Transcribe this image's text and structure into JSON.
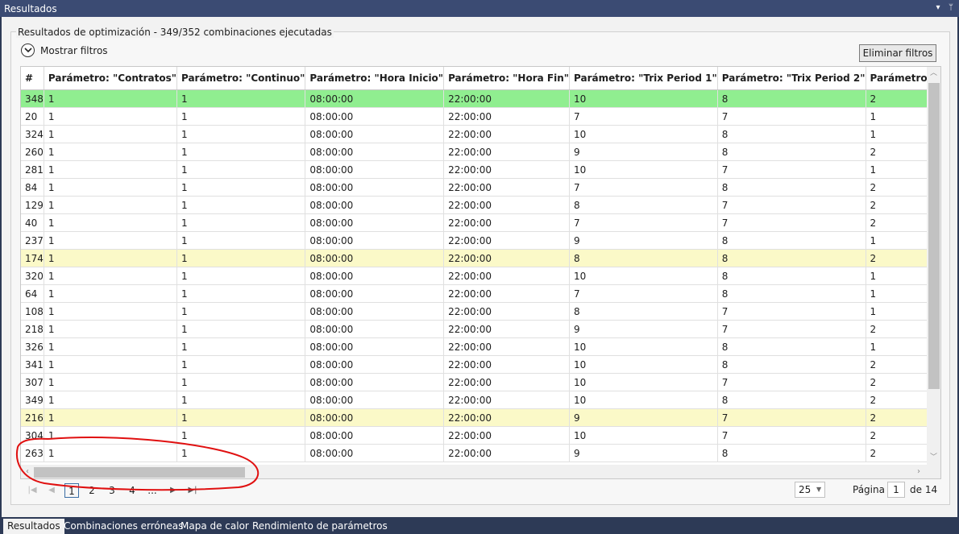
{
  "window": {
    "title": "Resultados"
  },
  "group": {
    "legend": "Resultados de optimización - 349/352 combinaciones ejecutadas"
  },
  "filters": {
    "toggle_label": "Mostrar filtros",
    "clear_label": "Eliminar filtros"
  },
  "grid": {
    "columns": [
      "#",
      "Parámetro: \"Contratos\"",
      "Parámetro: \"Continuo\"",
      "Parámetro: \"Hora Inicio\"",
      "Parámetro: \"Hora Fin\"",
      "Parámetro: \"Trix Period 1\"",
      "Parámetro: \"Trix Period 2\"",
      "Parámetro: \"Trix Perioc"
    ],
    "rows": [
      {
        "cells": [
          "348",
          "1",
          "1",
          "08:00:00",
          "22:00:00",
          "10",
          "8",
          "2"
        ],
        "state": "selected"
      },
      {
        "cells": [
          "20",
          "1",
          "1",
          "08:00:00",
          "22:00:00",
          "7",
          "7",
          "1"
        ],
        "state": ""
      },
      {
        "cells": [
          "324",
          "1",
          "1",
          "08:00:00",
          "22:00:00",
          "10",
          "8",
          "1"
        ],
        "state": ""
      },
      {
        "cells": [
          "260",
          "1",
          "1",
          "08:00:00",
          "22:00:00",
          "9",
          "8",
          "2"
        ],
        "state": ""
      },
      {
        "cells": [
          "281",
          "1",
          "1",
          "08:00:00",
          "22:00:00",
          "10",
          "7",
          "1"
        ],
        "state": ""
      },
      {
        "cells": [
          "84",
          "1",
          "1",
          "08:00:00",
          "22:00:00",
          "7",
          "8",
          "2"
        ],
        "state": ""
      },
      {
        "cells": [
          "129",
          "1",
          "1",
          "08:00:00",
          "22:00:00",
          "8",
          "7",
          "2"
        ],
        "state": ""
      },
      {
        "cells": [
          "40",
          "1",
          "1",
          "08:00:00",
          "22:00:00",
          "7",
          "7",
          "2"
        ],
        "state": ""
      },
      {
        "cells": [
          "237",
          "1",
          "1",
          "08:00:00",
          "22:00:00",
          "9",
          "8",
          "1"
        ],
        "state": ""
      },
      {
        "cells": [
          "174",
          "1",
          "1",
          "08:00:00",
          "22:00:00",
          "8",
          "8",
          "2"
        ],
        "state": "highlight"
      },
      {
        "cells": [
          "320",
          "1",
          "1",
          "08:00:00",
          "22:00:00",
          "10",
          "8",
          "1"
        ],
        "state": ""
      },
      {
        "cells": [
          "64",
          "1",
          "1",
          "08:00:00",
          "22:00:00",
          "7",
          "8",
          "1"
        ],
        "state": ""
      },
      {
        "cells": [
          "108",
          "1",
          "1",
          "08:00:00",
          "22:00:00",
          "8",
          "7",
          "1"
        ],
        "state": ""
      },
      {
        "cells": [
          "218",
          "1",
          "1",
          "08:00:00",
          "22:00:00",
          "9",
          "7",
          "2"
        ],
        "state": ""
      },
      {
        "cells": [
          "326",
          "1",
          "1",
          "08:00:00",
          "22:00:00",
          "10",
          "8",
          "1"
        ],
        "state": ""
      },
      {
        "cells": [
          "341",
          "1",
          "1",
          "08:00:00",
          "22:00:00",
          "10",
          "8",
          "2"
        ],
        "state": ""
      },
      {
        "cells": [
          "307",
          "1",
          "1",
          "08:00:00",
          "22:00:00",
          "10",
          "7",
          "2"
        ],
        "state": ""
      },
      {
        "cells": [
          "349",
          "1",
          "1",
          "08:00:00",
          "22:00:00",
          "10",
          "8",
          "2"
        ],
        "state": ""
      },
      {
        "cells": [
          "216",
          "1",
          "1",
          "08:00:00",
          "22:00:00",
          "9",
          "7",
          "2"
        ],
        "state": "highlight"
      },
      {
        "cells": [
          "304",
          "1",
          "1",
          "08:00:00",
          "22:00:00",
          "10",
          "7",
          "2"
        ],
        "state": ""
      },
      {
        "cells": [
          "263",
          "1",
          "1",
          "08:00:00",
          "22:00:00",
          "9",
          "8",
          "2"
        ],
        "state": ""
      }
    ]
  },
  "pager": {
    "pages": [
      "1",
      "2",
      "3",
      "4",
      "..."
    ],
    "current_page": "1",
    "page_size": "25",
    "page_label": "Página",
    "page_input": "1",
    "of_label": "de 14"
  },
  "tabs": [
    "Resultados",
    "Combinaciones erróneas",
    "Mapa de calor",
    "Rendimiento de parámetros"
  ],
  "colors": {
    "selected_row": "#90ee90",
    "highlight_row": "#fbf9c8",
    "annotation": "#e01010"
  }
}
